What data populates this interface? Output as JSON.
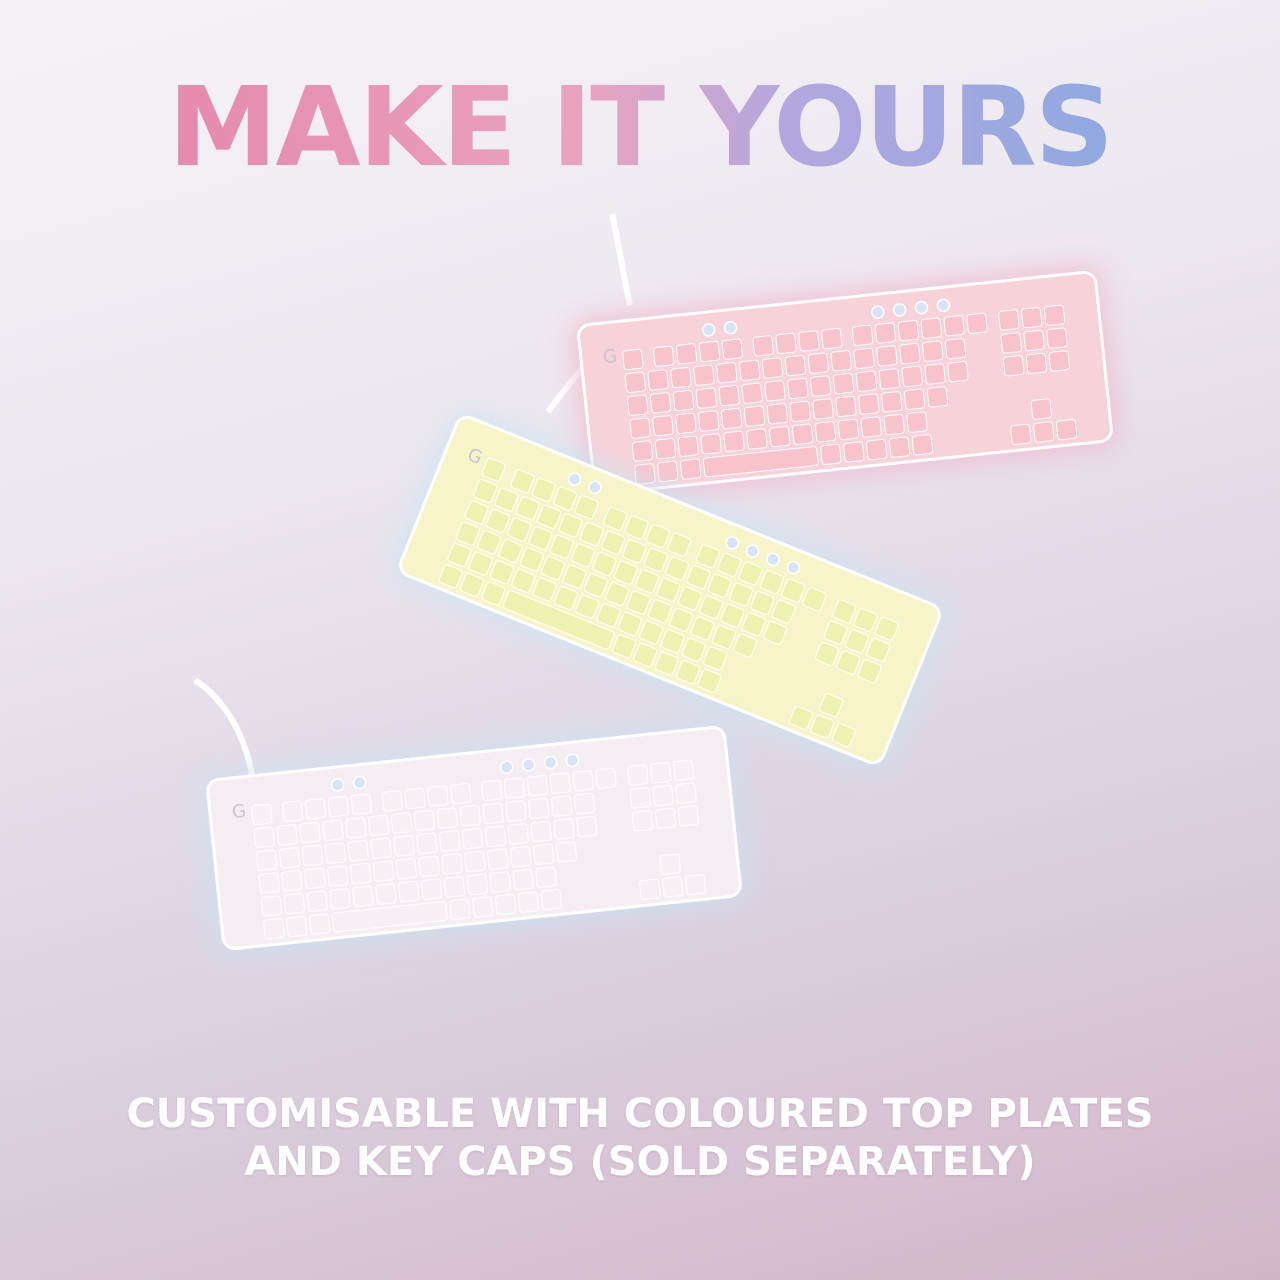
{
  "headline": "MAKE IT YOURS",
  "caption": {
    "line1": "CUSTOMISABLE WITH COLOURED TOP PLATES",
    "line2": "AND KEY CAPS (SOLD SEPARATELY)"
  },
  "keyboards": [
    {
      "name": "pink",
      "body": "#f7d2d8",
      "key": "#f9c3cc",
      "glow": "#f2b3c8"
    },
    {
      "name": "yellow",
      "body": "#f6f4c8",
      "key": "#eef1b0",
      "glow": "#c6e6f3"
    },
    {
      "name": "white",
      "body": "#f4eef2",
      "key": "#f6eff3",
      "glow": "#c9e2f1"
    }
  ],
  "colors": {
    "headline_start": "#e58aab",
    "headline_end": "#8fa9e0",
    "caption": "#ffffff"
  }
}
